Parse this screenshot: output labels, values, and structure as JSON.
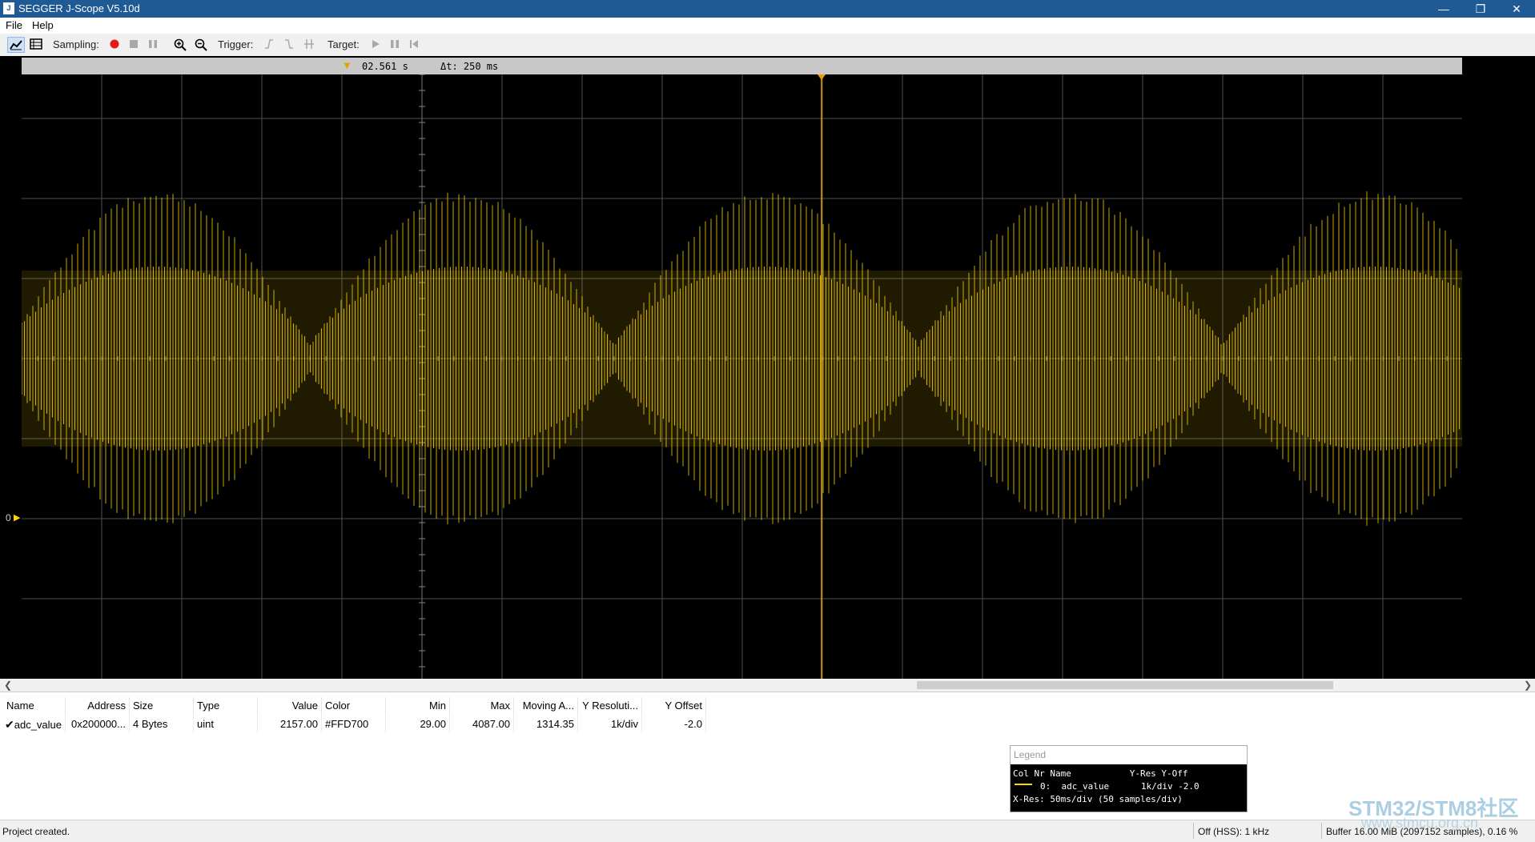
{
  "window": {
    "title": "SEGGER J-Scope V5.10d",
    "app_icon": "J"
  },
  "menu": [
    "File",
    "Help"
  ],
  "toolbar": {
    "sampling_label": "Sampling:",
    "trigger_label": "Trigger:",
    "target_label": "Target:"
  },
  "timebar": {
    "cursor_time": "02.561 s",
    "delta_label": "Δt: 250 ms"
  },
  "scope": {
    "zero_label": "0",
    "trace_color": "#ffd700"
  },
  "variables": {
    "headers": [
      "Name",
      "Address",
      "Size",
      "Type",
      "Value",
      "Color",
      "Min",
      "Max",
      "Moving A...",
      "Y Resoluti...",
      "Y Offset"
    ],
    "rows": [
      {
        "checked": true,
        "name": "adc_value",
        "address": "0x200000...",
        "size": "4 Bytes",
        "type": "uint",
        "value": "2157.00",
        "color": "#FFD700",
        "min": "29.00",
        "max": "4087.00",
        "moving_avg": "1314.35",
        "y_resolution": "1k/div",
        "y_offset": "-2.0"
      }
    ]
  },
  "legend": {
    "title": "Legend",
    "header": "Col Nr Name           Y-Res Y-Off",
    "entry": "0:  adc_value      1k/div -2.0",
    "xres": "X-Res: 50ms/div (50 samples/div)"
  },
  "status": {
    "left": "Project created.",
    "mode": "Off (HSS): 1 kHz",
    "buffer": "Buffer 16.00 MiB (2097152 samples), 0.16 %"
  },
  "watermark": {
    "line1": "STM32/STM8社区",
    "line2": "www.stmcu.org.cn"
  }
}
